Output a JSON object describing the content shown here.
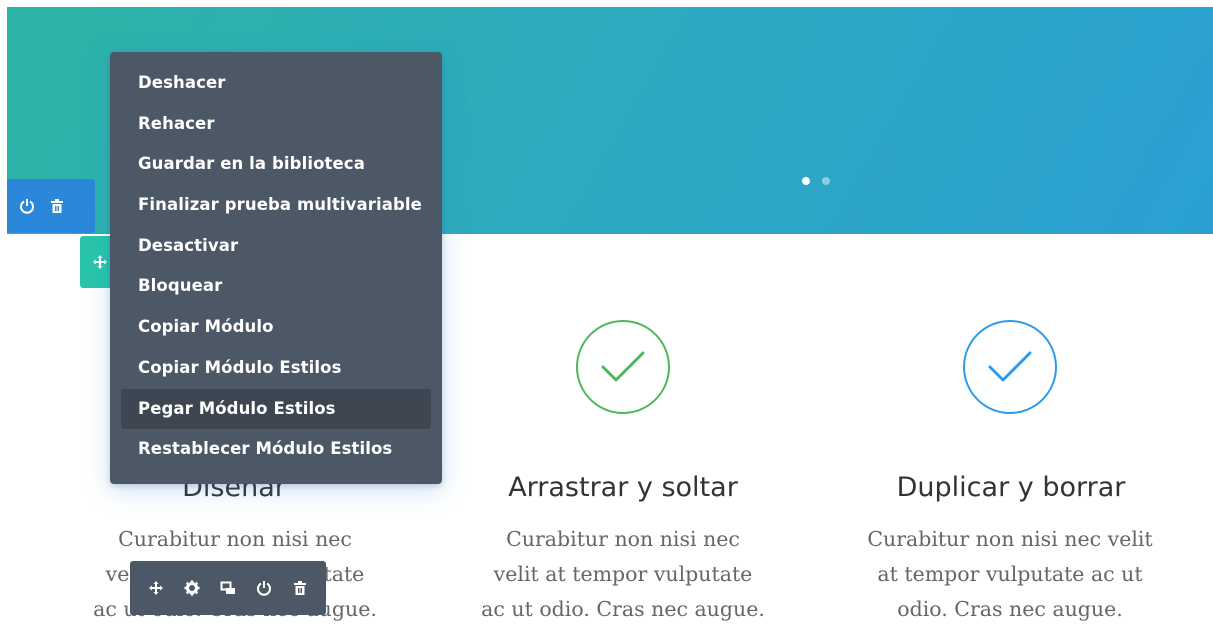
{
  "slider": {
    "dots": 2,
    "active_dot": 0
  },
  "section_controls": {
    "icons": [
      "power-icon",
      "trash-icon"
    ]
  },
  "row_controls": {
    "icons": [
      "move-icon"
    ]
  },
  "context_menu": {
    "items": [
      {
        "label": "Deshacer"
      },
      {
        "label": "Rehacer"
      },
      {
        "label": "Guardar en la biblioteca"
      },
      {
        "label": "Finalizar prueba multivariable"
      },
      {
        "label": "Desactivar"
      },
      {
        "label": "Bloquear"
      },
      {
        "label": "Copiar Módulo"
      },
      {
        "label": "Copiar Módulo Estilos"
      },
      {
        "label": "Pegar Módulo Estilos"
      },
      {
        "label": "Restablecer Módulo Estilos"
      }
    ],
    "highlighted_index": 8
  },
  "blurbs": [
    {
      "title": "Diseñar",
      "lines": [
        "Curabitur non nisi nec",
        "velit at tempor vulputate",
        "ac ut odio. Cras nec augue."
      ]
    },
    {
      "title": "Arrastrar y soltar",
      "icon_color": "#4fb75a",
      "lines": [
        "Curabitur non nisi nec",
        "velit at tempor vulputate",
        "ac ut odio. Cras nec augue."
      ]
    },
    {
      "title": "Duplicar y borrar",
      "icon_color": "#2b9bea",
      "lines": [
        "Curabitur non nisi nec velit",
        "at tempor vulputate ac ut",
        "odio. Cras nec augue."
      ]
    }
  ],
  "module_toolbar": {
    "icons": [
      "move-icon",
      "gear-icon",
      "duplicate-icon",
      "power-icon",
      "trash-icon"
    ]
  },
  "colors": {
    "hero_start": "#2db4a5",
    "hero_end": "#2b9fd3",
    "section_blue": "#2b87da",
    "row_teal": "#29c4a9",
    "menu_bg": "#4c5866"
  }
}
